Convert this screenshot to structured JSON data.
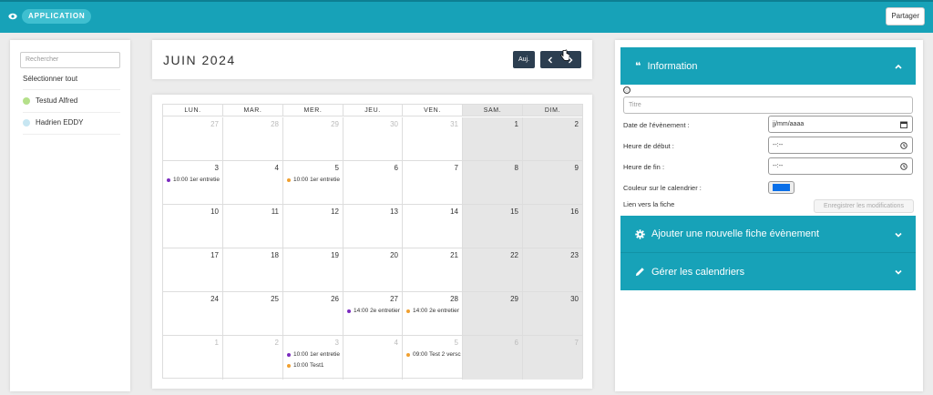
{
  "topbar": {
    "app_label": "APPLICATION",
    "share_label": "Partager"
  },
  "colors": {
    "accent": "#17a2b8",
    "dark_button": "#2c3e50",
    "purple": "#7b2bbf",
    "orange": "#f0a030",
    "swatch": "#0a6fe8"
  },
  "sidebar": {
    "search_placeholder": "Rechercher",
    "select_all": "Sélectionner tout",
    "people": [
      {
        "name": "Testud Alfred",
        "color": "#b5e08a"
      },
      {
        "name": "Hadrien EDDY",
        "color": "#c7e6f2"
      }
    ]
  },
  "calendar": {
    "month_title": "JUIN 2024",
    "today_label": "Auj.",
    "weekdays": [
      "LUN.",
      "MAR.",
      "MER.",
      "JEU.",
      "VEN.",
      "SAM.",
      "DIM."
    ],
    "weeks": [
      [
        {
          "n": "27",
          "o": true
        },
        {
          "n": "28",
          "o": true
        },
        {
          "n": "29",
          "o": true
        },
        {
          "n": "30",
          "o": true
        },
        {
          "n": "31",
          "o": true
        },
        {
          "n": "1"
        },
        {
          "n": "2"
        }
      ],
      [
        {
          "n": "3",
          "events": [
            {
              "t": "10:00 1er entretie",
              "c": "purple"
            }
          ]
        },
        {
          "n": "4"
        },
        {
          "n": "5",
          "events": [
            {
              "t": "10:00 1er entretie",
              "c": "orange"
            }
          ]
        },
        {
          "n": "6"
        },
        {
          "n": "7"
        },
        {
          "n": "8"
        },
        {
          "n": "9"
        }
      ],
      [
        {
          "n": "10"
        },
        {
          "n": "11"
        },
        {
          "n": "12"
        },
        {
          "n": "13"
        },
        {
          "n": "14"
        },
        {
          "n": "15"
        },
        {
          "n": "16"
        }
      ],
      [
        {
          "n": "17"
        },
        {
          "n": "18"
        },
        {
          "n": "19"
        },
        {
          "n": "20"
        },
        {
          "n": "21"
        },
        {
          "n": "22"
        },
        {
          "n": "23"
        }
      ],
      [
        {
          "n": "24"
        },
        {
          "n": "25"
        },
        {
          "n": "26"
        },
        {
          "n": "27",
          "events": [
            {
              "t": "14:00 2e entretier",
              "c": "purple"
            }
          ]
        },
        {
          "n": "28",
          "events": [
            {
              "t": "14:00 2e entretier",
              "c": "orange"
            }
          ]
        },
        {
          "n": "29"
        },
        {
          "n": "30"
        }
      ],
      [
        {
          "n": "1",
          "o": true
        },
        {
          "n": "2",
          "o": true
        },
        {
          "n": "3",
          "o": true,
          "events": [
            {
              "t": "10:00 1er entretie",
              "c": "purple"
            },
            {
              "t": "10:00 Test1",
              "c": "orange"
            }
          ]
        },
        {
          "n": "4",
          "o": true
        },
        {
          "n": "5",
          "o": true,
          "events": [
            {
              "t": "09:00 Test 2 versc",
              "c": "orange"
            }
          ]
        },
        {
          "n": "6",
          "o": true
        },
        {
          "n": "7",
          "o": true
        }
      ]
    ]
  },
  "info_panel": {
    "title": "Information",
    "info_icon": "ⓘ",
    "title_placeholder": "Titre",
    "date_label": "Date de l'évènement :",
    "date_placeholder": "jj/mm/aaaa",
    "start_label": "Heure de début :",
    "end_label": "Heure de fin :",
    "time_placeholder": "--:--",
    "color_label": "Couleur sur le calendrier :",
    "link_label": "Lien vers la fiche",
    "save_label": "Enregistrer les modifications"
  },
  "accordions": {
    "add_event": "Ajouter une nouvelle fiche évènement",
    "manage": "Gérer les calendriers"
  }
}
